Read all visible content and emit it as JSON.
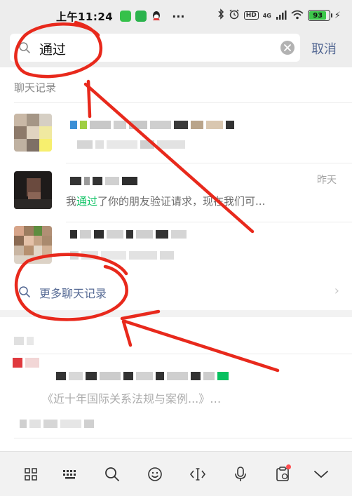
{
  "status_bar": {
    "time": "上午11:24",
    "more": "···",
    "hd": "HD",
    "network": "4G",
    "battery": "93"
  },
  "search": {
    "query": "通过",
    "cancel": "取消"
  },
  "section": {
    "chat_records_title": "聊天记录"
  },
  "results": [
    {
      "date": "",
      "snippet_prefix": "",
      "snippet_highlight": "",
      "snippet_suffix": ""
    },
    {
      "date": "昨天",
      "snippet_prefix": "我",
      "snippet_highlight": "通过",
      "snippet_suffix": "了你的朋友验证请求，现在我们可..."
    },
    {
      "date": "",
      "snippet_prefix": "",
      "snippet_highlight": "",
      "snippet_suffix": ""
    }
  ],
  "more_records": {
    "label": "更多聊天记录"
  },
  "second_section": {
    "snippet": "《近十年国际关系法规与案例...》…"
  },
  "toolbar": {
    "icons": [
      "grid-icon",
      "keyboard-icon",
      "search-icon",
      "emoji-icon",
      "cursor-icon",
      "microphone-icon",
      "clipboard-icon",
      "chevron-down-icon"
    ]
  },
  "colors": {
    "accent_green": "#07c160",
    "link_blue": "#576b95",
    "annotation_red": "#e8291c"
  }
}
